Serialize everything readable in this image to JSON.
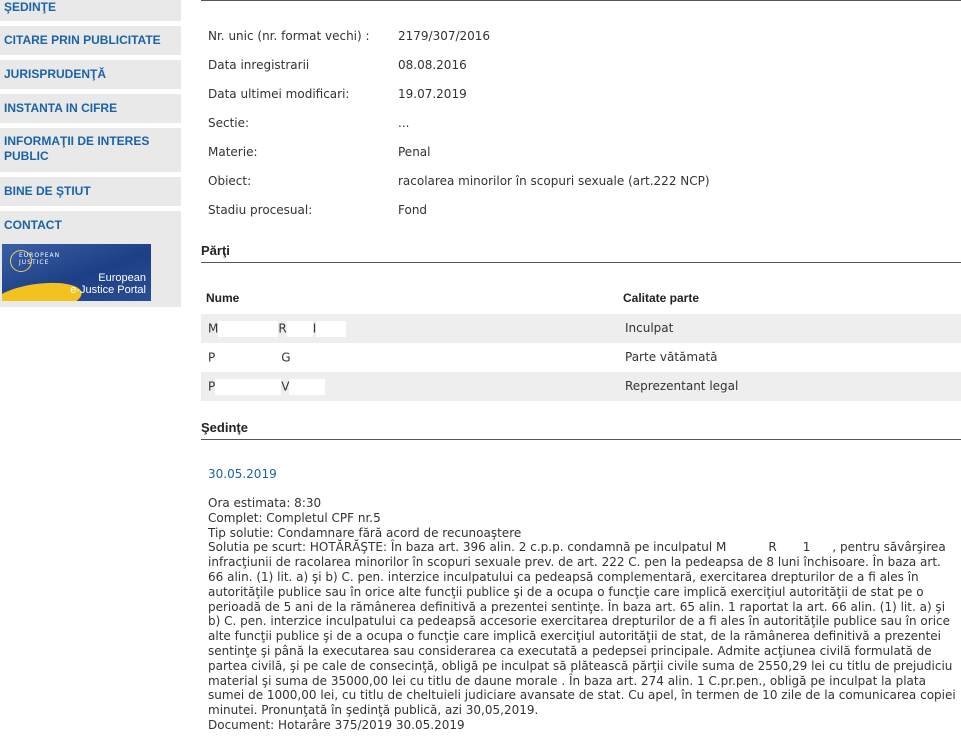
{
  "sidebar": {
    "nav": [
      {
        "label": "ŞEDINŢE"
      },
      {
        "label": "CITARE PRIN PUBLICITATE"
      },
      {
        "label": "JURISPRUDENŢĂ"
      },
      {
        "label": "INSTANTA IN CIFRE"
      },
      {
        "label": "INFORMAŢII DE INTERES PUBLIC"
      },
      {
        "label": "BINE DE ŞTIUT"
      },
      {
        "label": "CONTACT"
      }
    ],
    "banner": {
      "small_text_1": "EUROPEAN",
      "small_text_2": "JUSTICE",
      "title_1": "European",
      "title_2": "e-Justice Portal"
    }
  },
  "case_info": [
    {
      "label": "Nr. unic (nr. format vechi) :",
      "value": "2179/307/2016"
    },
    {
      "label": "Data inregistrarii",
      "value": "08.08.2016"
    },
    {
      "label": "Data ultimei modificari:",
      "value": "19.07.2019"
    },
    {
      "label": "Sectie:",
      "value": "..."
    },
    {
      "label": "Materie:",
      "value": "Penal"
    },
    {
      "label": "Obiect:",
      "value": "racolarea minorilor în scopuri sexuale (art.222 NCP)"
    },
    {
      "label": "Stadiu procesual:",
      "value": "Fond"
    }
  ],
  "parties": {
    "title": "Părţi",
    "col_name": "Nume",
    "col_role": "Calitate parte",
    "rows": [
      {
        "name_a": "M",
        "name_b": "R",
        "name_c": "I",
        "role": "Inculpat"
      },
      {
        "name_a": "P",
        "name_b": "G",
        "name_c": "",
        "role": "Parte vătămată"
      },
      {
        "name_a": "P",
        "name_b": "V",
        "name_c": "",
        "role": "Reprezentant legal"
      }
    ]
  },
  "sessions": {
    "title": "Şedinţe",
    "date": "30.05.2019",
    "ora": "Ora estimata: 8:30",
    "complet": "Complet: Completul CPF nr.5",
    "tip": "Tip solutie: Condamnare fără acord de recunoaştere",
    "solutie_start": "Solutia pe scurt: HOTĂRĂŞTE: În baza art. 396 alin. 2 c.p.p. condamnă pe inculpatul M",
    "solutie_mid1": "R",
    "solutie_mid2": "1",
    "solutie_rest": ", pentru săvârşirea infracţiunii de racolarea minorilor în scopuri sexuale prev. de art. 222 C. pen la pedeapsa de 8 luni închisoare. În baza art. 66 alin. (1) lit. a) şi b) C. pen. interzice inculpatului ca pedeapsă complementară, exercitarea drepturilor de a fi ales în autorităţile publice sau în orice alte funcţii publice şi de a ocupa o funcţie care implică exerciţiul autorităţii de stat pe o perioadă de 5 ani de la rămânerea definitivă a prezentei sentinţe. În baza art. 65 alin. 1 raportat la art. 66 alin. (1) lit. a) şi b) C. pen. interzice inculpatului ca pedeapsă accesorie exercitarea drepturilor de a fi ales în autorităţile publice sau în orice alte funcţii publice şi de a ocupa o funcţie care implică exerciţiul autorităţii de stat, de la rămânerea definitivă a prezentei sentinţe şi până la executarea sau considerarea ca executată a pedepsei principale. Admite acţiunea civilă formulată de partea civilă, şi pe cale de consecinţă, obligă pe inculpat să plătească părţii civile suma de 2550,29 lei cu titlu de prejudiciu material şi suma de 35000,00 lei cu titlu de daune morale . În baza art. 274 alin. 1 C.pr.pen., obligă pe inculpat la plata sumei de 1000,00 lei, cu titlu de cheltuieli judiciare avansate de stat. Cu apel, în termen de 10 zile de la comunicarea copiei minutei. Pronunţată în şedinţă publică, azi 30,05,2019.",
    "document": "Document: Hotarâre  375/2019  30.05.2019"
  }
}
